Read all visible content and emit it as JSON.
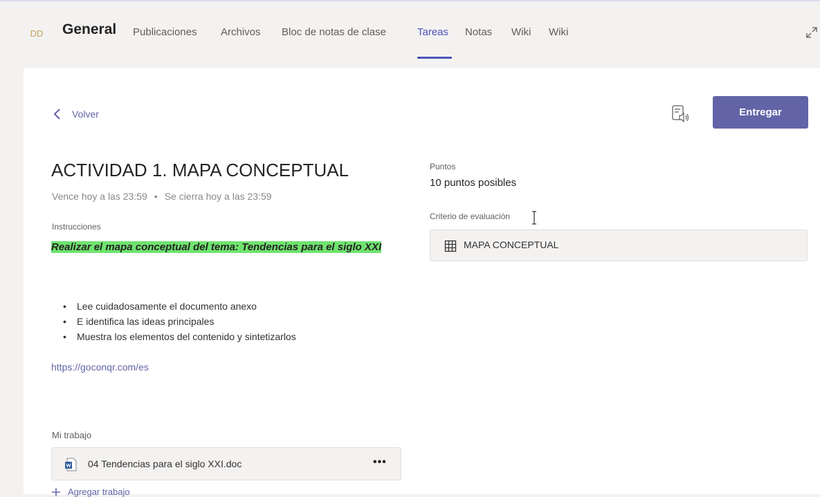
{
  "header": {
    "avatar_initials": "DD",
    "channel_name": "General",
    "tabs": [
      {
        "label": "Publicaciones"
      },
      {
        "label": "Archivos"
      },
      {
        "label": "Bloc de notas de clase"
      },
      {
        "label": "Tareas",
        "active": true
      },
      {
        "label": "Notas"
      },
      {
        "label": "Wiki"
      },
      {
        "label": "Wiki"
      }
    ],
    "expand_icon": "expand-icon"
  },
  "toolbar": {
    "back_label": "Volver",
    "immersive_reader_icon": "immersive-reader-icon",
    "submit_label": "Entregar"
  },
  "assignment": {
    "title": "ACTIVIDAD 1. MAPA CONCEPTUAL",
    "due": "Vence hoy a las 23:59",
    "separator": "•",
    "closes": "Se cierra hoy a las 23:59",
    "instructions_label": "Instrucciones",
    "instructions_highlight": "Realizar el mapa conceptual del tema: Tendencias para el siglo XXI",
    "bullets": [
      "Lee cuidadosamente el documento anexo",
      "E identifica las ideas principales",
      "Muestra los elementos del contenido y sintetizarlos"
    ],
    "link": "https://goconqr.com/es"
  },
  "grading": {
    "points_label": "Puntos",
    "points_value": "10 puntos posibles",
    "rubric_label": "Criterio de evaluación",
    "rubric_name": "MAPA CONCEPTUAL"
  },
  "my_work": {
    "label": "Mi trabajo",
    "file_name": "04 Tendencias para el siglo XXI.doc",
    "more_label": "•••",
    "add_label": "Agregar trabajo"
  },
  "colors": {
    "accent": "#6264a7",
    "highlight": "#6fe36f",
    "background": "#f3f2f1"
  }
}
